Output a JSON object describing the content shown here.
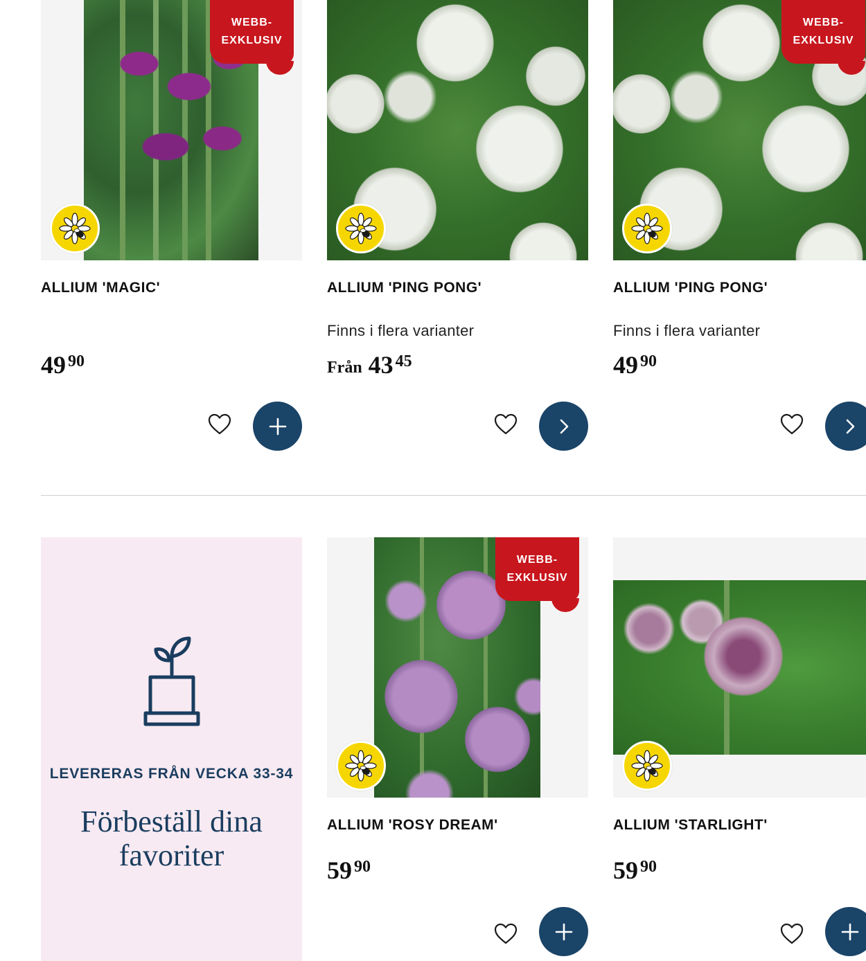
{
  "badges": {
    "web_exclusive_line1": "WEBB-",
    "web_exclusive_line2": "EXKLUSIV"
  },
  "products": [
    {
      "title": "ALLIUM 'MAGIC'",
      "variants_text": "",
      "price_prefix": "",
      "price_main": "49",
      "price_decimals": "90",
      "web_exclusive": true,
      "action": "add-to-cart"
    },
    {
      "title": "ALLIUM 'PING PONG'",
      "variants_text": "Finns i flera varianter",
      "price_prefix": "Från",
      "price_main": "43",
      "price_decimals": "45",
      "web_exclusive": false,
      "action": "view-options"
    },
    {
      "title": "ALLIUM 'PING PONG'",
      "variants_text": "Finns i flera varianter",
      "price_prefix": "",
      "price_main": "49",
      "price_decimals": "90",
      "web_exclusive": true,
      "action": "view-options"
    },
    {
      "title": "ALLIUM 'ROSY DREAM'",
      "variants_text": "",
      "price_prefix": "",
      "price_main": "59",
      "price_decimals": "90",
      "web_exclusive": true,
      "action": "add-to-cart"
    },
    {
      "title": "ALLIUM 'STARLIGHT'",
      "variants_text": "",
      "price_prefix": "",
      "price_main": "59",
      "price_decimals": "90",
      "web_exclusive": false,
      "action": "add-to-cart"
    }
  ],
  "promo": {
    "kicker": "LEVERERAS FRÅN VECKA 33-34",
    "headline_line1": "Förbeställ dina",
    "headline_line2": "favoriter",
    "icon": "plant-pot-icon"
  },
  "icons": {
    "pollinator": "bee-flower-icon",
    "favorite": "heart-icon",
    "add": "plus-icon",
    "more": "chevron-right-icon"
  },
  "colors": {
    "badge_red": "#c8161e",
    "button_navy": "#1a4468",
    "bee_yellow": "#f6d600",
    "promo_pink": "#f8eaf2",
    "promo_text": "#1a3d5f"
  }
}
